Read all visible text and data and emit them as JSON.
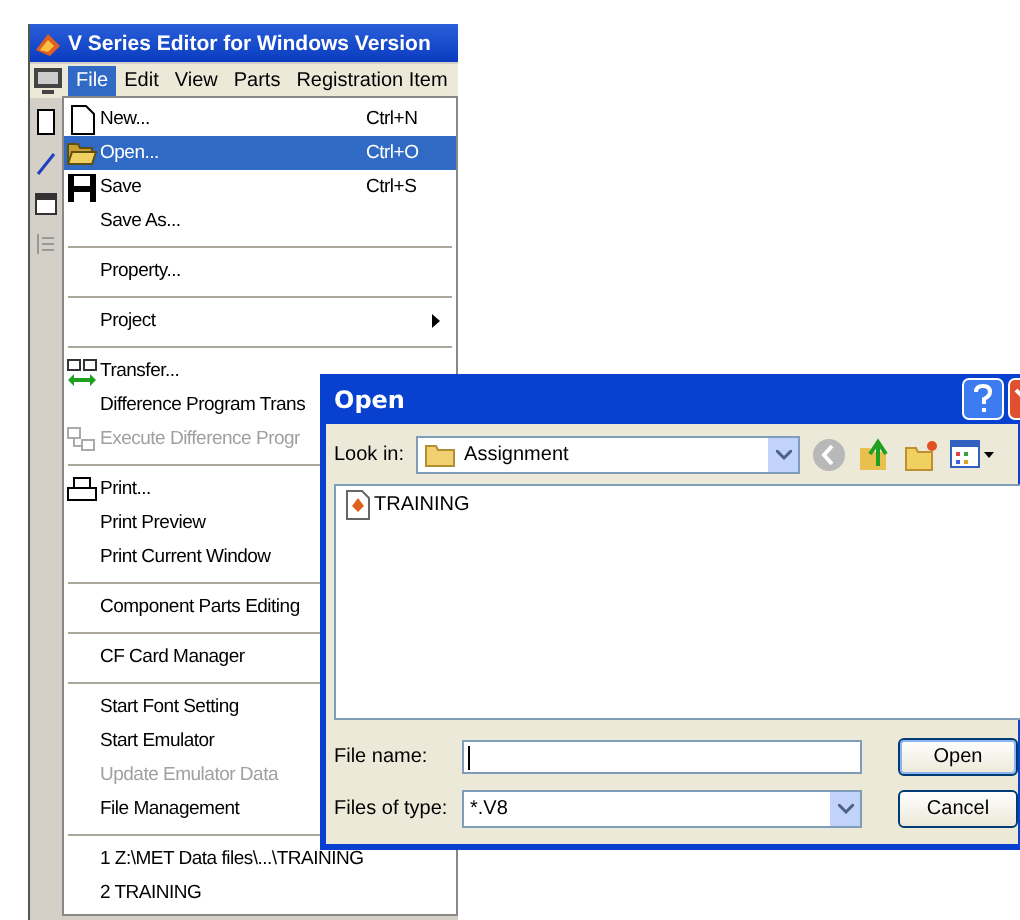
{
  "app": {
    "title": "V Series Editor for Windows Version",
    "menu_bar": [
      {
        "label": "File",
        "selected": true
      },
      {
        "label": "Edit",
        "selected": false
      },
      {
        "label": "View",
        "selected": false
      },
      {
        "label": "Parts",
        "selected": false
      },
      {
        "label": "Registration Item",
        "selected": false
      }
    ],
    "file_menu": [
      {
        "kind": "item",
        "label": "New...",
        "shortcut": "Ctrl+N",
        "selected": false,
        "disabled": false
      },
      {
        "kind": "item",
        "label": "Open...",
        "shortcut": "Ctrl+O",
        "selected": true,
        "disabled": false
      },
      {
        "kind": "item",
        "label": "Save",
        "shortcut": "Ctrl+S",
        "selected": false,
        "disabled": false
      },
      {
        "kind": "item",
        "label": "Save As...",
        "selected": false,
        "disabled": false
      },
      {
        "kind": "separator"
      },
      {
        "kind": "item",
        "label": "Property...",
        "selected": false,
        "disabled": false
      },
      {
        "kind": "separator"
      },
      {
        "kind": "submenu",
        "label": "Project",
        "selected": false,
        "disabled": false
      },
      {
        "kind": "separator"
      },
      {
        "kind": "item",
        "label": "Transfer...",
        "selected": false,
        "disabled": false
      },
      {
        "kind": "item",
        "label": "Difference Program Trans",
        "selected": false,
        "disabled": false
      },
      {
        "kind": "item",
        "label": "Execute Difference Progr",
        "selected": false,
        "disabled": true
      },
      {
        "kind": "separator"
      },
      {
        "kind": "item",
        "label": "Print...",
        "selected": false,
        "disabled": false
      },
      {
        "kind": "item",
        "label": "Print Preview",
        "selected": false,
        "disabled": false
      },
      {
        "kind": "item",
        "label": "Print Current Window",
        "selected": false,
        "disabled": false
      },
      {
        "kind": "separator"
      },
      {
        "kind": "item",
        "label": "Component Parts Editing",
        "selected": false,
        "disabled": false
      },
      {
        "kind": "separator"
      },
      {
        "kind": "item",
        "label": "CF Card Manager",
        "selected": false,
        "disabled": false
      },
      {
        "kind": "separator"
      },
      {
        "kind": "item",
        "label": "Start Font Setting",
        "selected": false,
        "disabled": false
      },
      {
        "kind": "item",
        "label": "Start Emulator",
        "selected": false,
        "disabled": false
      },
      {
        "kind": "item",
        "label": "Update Emulator Data",
        "selected": false,
        "disabled": true
      },
      {
        "kind": "item",
        "label": "File Management",
        "selected": false,
        "disabled": false
      },
      {
        "kind": "separator"
      },
      {
        "kind": "item",
        "label": "1 Z:\\MET Data files\\...\\TRAINING",
        "selected": false,
        "disabled": false
      },
      {
        "kind": "item",
        "label": "2 TRAINING",
        "selected": false,
        "disabled": false
      }
    ]
  },
  "open_dialog": {
    "title": "Open",
    "look_in": {
      "label": "Look in:",
      "value": "Assignment"
    },
    "files": [
      {
        "name": "TRAINING",
        "selected": false
      }
    ],
    "file_name": {
      "label": "File name:"
    },
    "files_of_type": {
      "label": "Files of type:",
      "value": "*.V8"
    },
    "buttons": [
      "Open",
      "Cancel"
    ]
  }
}
